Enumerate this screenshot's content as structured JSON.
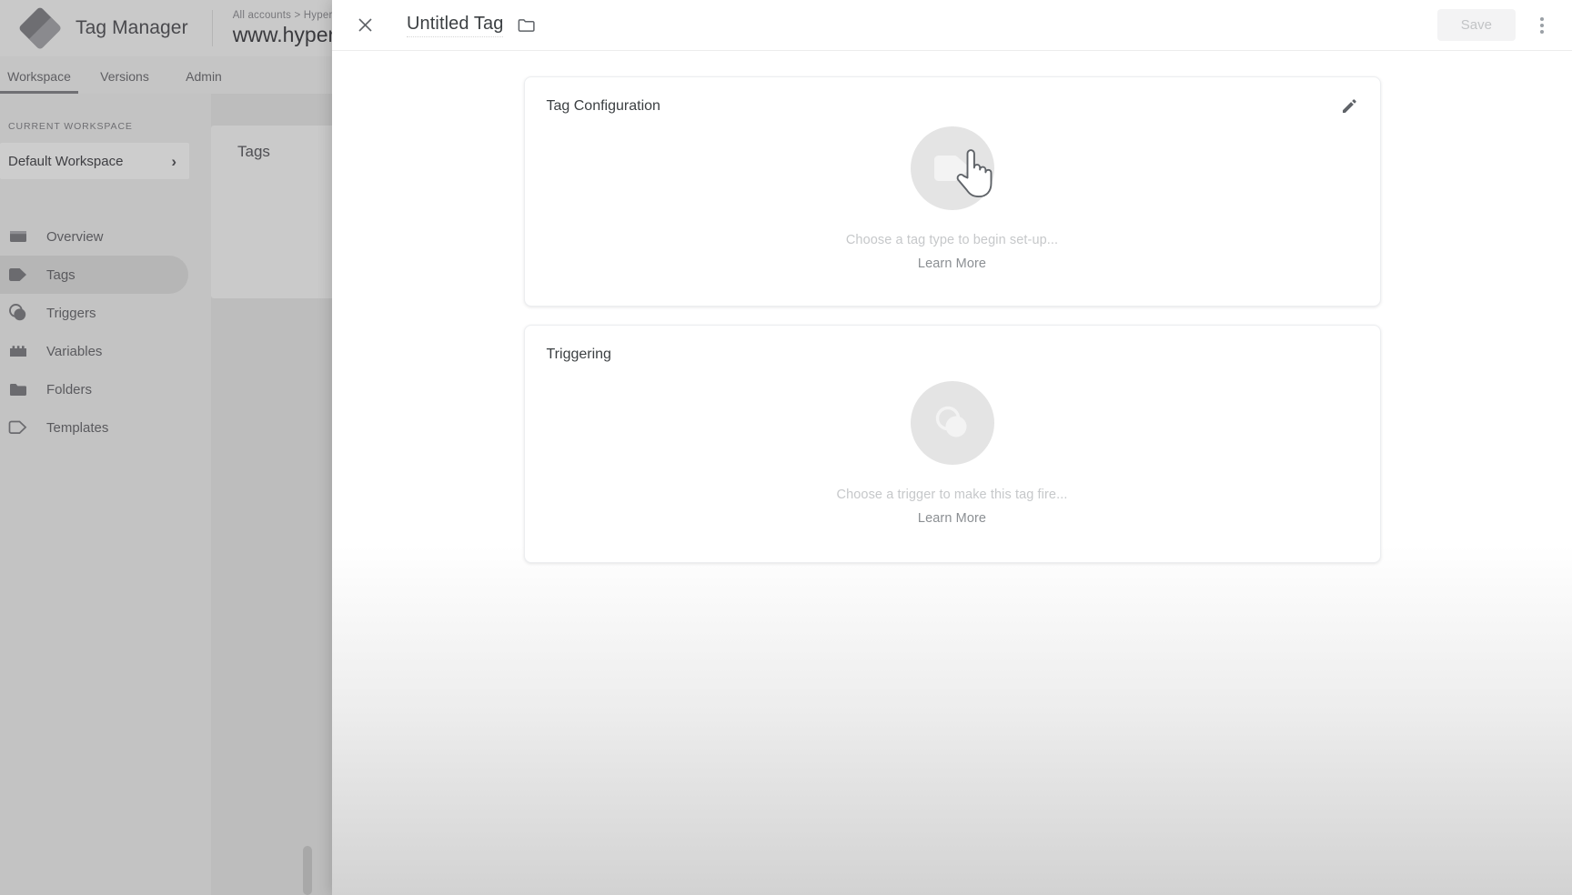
{
  "background_app": {
    "brand": {
      "name": "Tag Manager",
      "logo_icon": "gtm-diamond-logo"
    },
    "account": {
      "breadcrumb": "All accounts > Hyperi",
      "container": "www.hypera"
    },
    "tabs": [
      {
        "label": "Workspace",
        "active": true
      },
      {
        "label": "Versions",
        "active": false
      },
      {
        "label": "Admin",
        "active": false
      }
    ],
    "sidebar": {
      "section_label": "CURRENT WORKSPACE",
      "workspace_name": "Default Workspace",
      "chevron_icon": "chevron-right-icon",
      "items": [
        {
          "label": "Overview",
          "icon": "overview-icon",
          "selected": false
        },
        {
          "label": "Tags",
          "icon": "tag-icon",
          "selected": true
        },
        {
          "label": "Triggers",
          "icon": "trigger-icon",
          "selected": false
        },
        {
          "label": "Variables",
          "icon": "variables-icon",
          "selected": false
        },
        {
          "label": "Folders",
          "icon": "folder-icon",
          "selected": false
        },
        {
          "label": "Templates",
          "icon": "template-icon",
          "selected": false
        }
      ]
    },
    "panel": {
      "title": "Tags"
    }
  },
  "modal": {
    "close_icon": "close-icon",
    "title": "Untitled Tag",
    "folder_icon": "folder-icon",
    "save_label": "Save",
    "save_disabled": true,
    "kebab_icon": "more-vert-icon",
    "cards": [
      {
        "title": "Tag Configuration",
        "edit_icon": "pencil-edit-icon",
        "placeholder_icon": "tag-icon",
        "cursor_icon": "pointing-hand-cursor",
        "hint": "Choose a tag type to begin set-up...",
        "link": "Learn More"
      },
      {
        "title": "Triggering",
        "placeholder_icon": "trigger-icon",
        "hint": "Choose a trigger to make this tag fire...",
        "link": "Learn More"
      }
    ]
  },
  "colors": {
    "card_bg": "#ffffff",
    "modal_bg": "#ffffff",
    "dim_overlay": "#bdbdbd",
    "placeholder_circle": "#e4e4e4",
    "hint_text": "#c6c8ca",
    "link_text": "#8b8f93",
    "save_disabled_text": "#c2c4c6"
  }
}
